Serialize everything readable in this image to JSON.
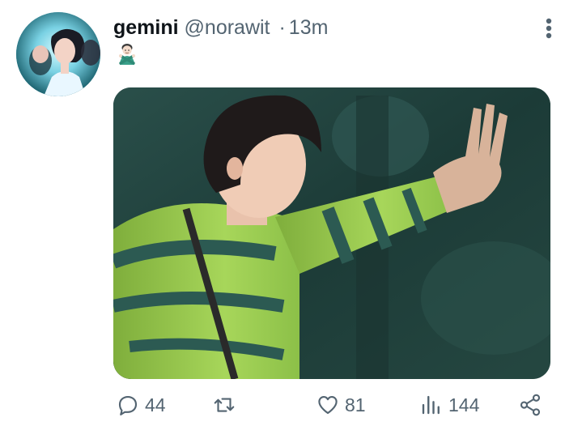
{
  "tweet": {
    "display_name": "gemini",
    "handle": "@norawit",
    "separator": "·",
    "time": "13m",
    "emoji": "🙅🏻‍♂️"
  },
  "actions": {
    "replies": "44",
    "retweets": "",
    "likes": "81",
    "views": "144"
  },
  "colors": {
    "text_primary": "#0f1419",
    "text_secondary": "#536471",
    "background": "#ffffff"
  },
  "icons": {
    "reply": "reply-icon",
    "retweet": "retweet-icon",
    "like": "heart-icon",
    "views": "views-icon",
    "share": "share-icon",
    "more": "more-icon"
  }
}
